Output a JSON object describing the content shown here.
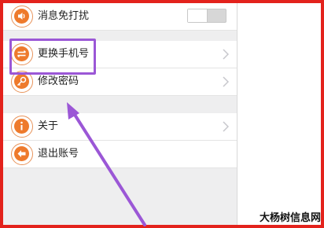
{
  "settings": {
    "items": [
      {
        "label": "消息免打扰",
        "icon": "speaker-icon",
        "control": "toggle",
        "toggle_on": false
      },
      {
        "label": "更换手机号",
        "icon": "phone-swap-icon",
        "control": "chevron"
      },
      {
        "label": "修改密码",
        "icon": "key-icon",
        "control": "chevron"
      },
      {
        "label": "关于",
        "icon": "info-icon",
        "control": "chevron"
      },
      {
        "label": "退出账号",
        "icon": "logout-icon",
        "control": "none"
      }
    ]
  },
  "annotation": {
    "highlight_target": "更换手机号",
    "highlight_color": "#9b57d6",
    "arrow_color": "#9b57d6"
  },
  "watermark": {
    "text": "大杨树信息网"
  },
  "colors": {
    "frame": "#e3221c",
    "accent": "#ee7a2c",
    "background": "#eeeeef"
  }
}
